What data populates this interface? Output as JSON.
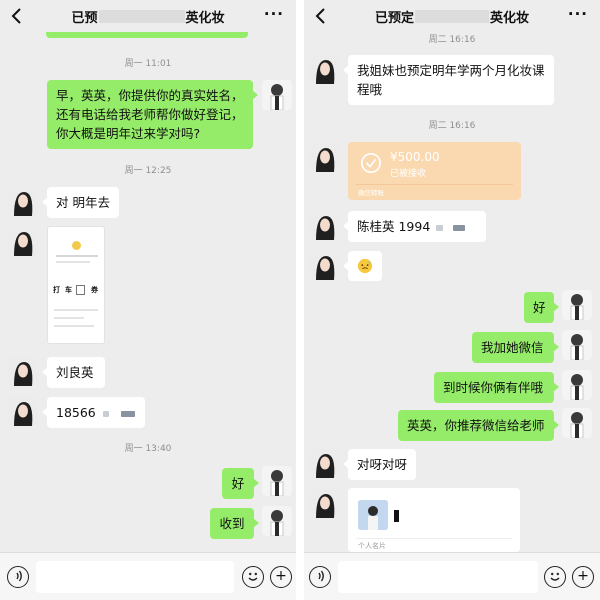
{
  "left": {
    "title_start": "已预",
    "title_end": "英化妆",
    "times": [
      "周一 11:01",
      "周一 12:25",
      "周一 13:40"
    ],
    "messages": {
      "m1": "早，英英，你提供你的真实姓名，还有电话给我老师帮你做好登记，你大概是明年过来学对吗?",
      "m2": "对 明年去",
      "m3_image": {
        "row1": "打",
        "row2": "车",
        "row3": "券"
      },
      "m4": "刘良英",
      "m5": "18566",
      "m6": "好",
      "m7": "收到"
    }
  },
  "right": {
    "title_start": "已预定",
    "title_end": "英化妆",
    "times": [
      "周二 16:16",
      "周二 16:16"
    ],
    "messages": {
      "r1": "我姐妹也预定明年学两个月化妆课程哦",
      "transfer_amount": "¥500.00",
      "transfer_status": "已被接收",
      "transfer_footer": "微信转账",
      "r3": "陈桂英 1994",
      "r5": "好",
      "r6": "我加她微信",
      "r7": "到时候你俩有伴哦",
      "r8": "英英，你推荐微信给老师",
      "r9": "对呀对呀",
      "card_label": "个人名片"
    }
  },
  "icons": {
    "back": "back-arrow-icon",
    "more": "more-icon",
    "voice": "voice-icon",
    "emoji": "emoji-icon",
    "plus": "plus-icon"
  },
  "colors": {
    "bg": "#ededed",
    "green_bubble": "#95ec69",
    "white_bubble": "#ffffff",
    "transfer": "#fbd9b0"
  }
}
